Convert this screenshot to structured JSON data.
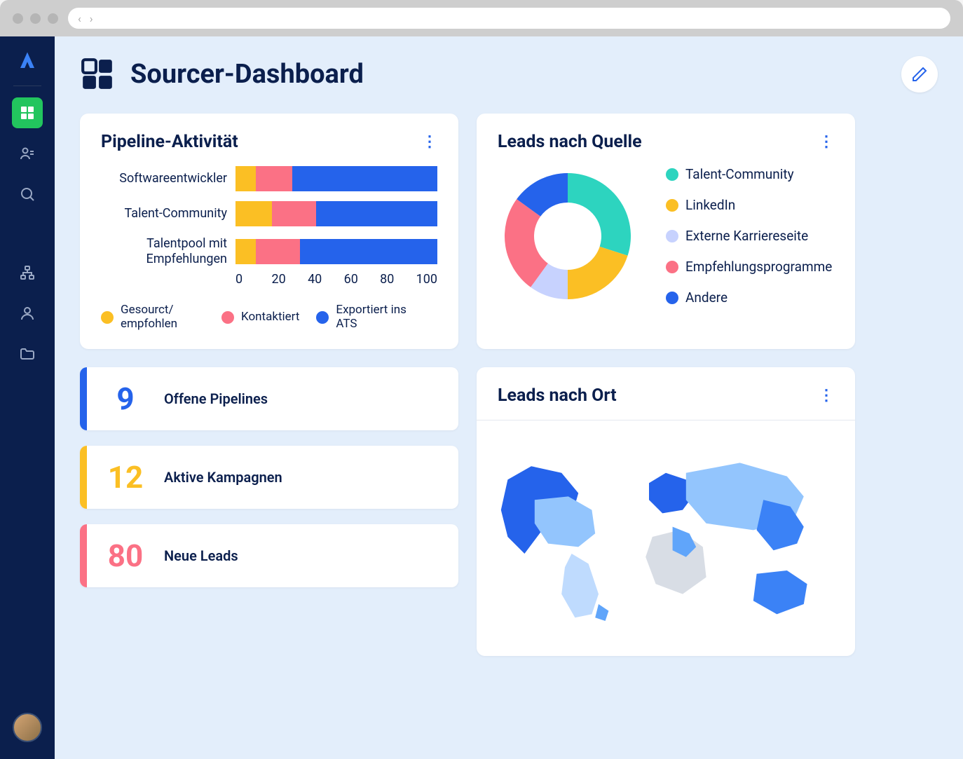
{
  "page": {
    "title": "Sourcer-Dashboard"
  },
  "cards": {
    "pipeline": {
      "title": "Pipeline-Aktivität"
    },
    "source": {
      "title": "Leads nach Quelle"
    },
    "location": {
      "title": "Leads nach Ort"
    }
  },
  "stats": [
    {
      "value": "9",
      "label": "Offene Pipelines",
      "color": "#2563eb"
    },
    {
      "value": "12",
      "label": "Aktive Kampagnen",
      "color": "#fbbf24"
    },
    {
      "value": "80",
      "label": "Neue Leads",
      "color": "#fb7185"
    }
  ],
  "chart_data": [
    {
      "type": "bar",
      "title": "Pipeline-Aktivität",
      "orientation": "horizontal",
      "stacked": true,
      "xlim": [
        0,
        100
      ],
      "xticks": [
        0,
        20,
        40,
        60,
        80,
        100
      ],
      "categories": [
        "Softwareentwickler",
        "Talent-Community",
        "Talentpool mit Empfehlungen"
      ],
      "series": [
        {
          "name": "Gesourct/ empfohlen",
          "color": "#fbbf24",
          "values": [
            10,
            18,
            10
          ]
        },
        {
          "name": "Kontaktiert",
          "color": "#fb7185",
          "values": [
            18,
            22,
            22
          ]
        },
        {
          "name": "Exportiert ins ATS",
          "color": "#2563eb",
          "values": [
            72,
            60,
            68
          ]
        }
      ]
    },
    {
      "type": "pie",
      "subtype": "donut",
      "title": "Leads nach Quelle",
      "series": [
        {
          "name": "Talent-Community",
          "color": "#2dd4bf",
          "value": 30
        },
        {
          "name": "LinkedIn",
          "color": "#fbbf24",
          "value": 20
        },
        {
          "name": "Externe Karriereseite",
          "color": "#c7d2fe",
          "value": 10
        },
        {
          "name": "Empfehlungsprogramme",
          "color": "#fb7185",
          "value": 25
        },
        {
          "name": "Andere",
          "color": "#2563eb",
          "value": 15
        }
      ]
    },
    {
      "type": "map",
      "title": "Leads nach Ort",
      "note": "Weltkarte Choroplethenkarte, blaue Abstufungen nach Lead-Anzahl pro Land"
    }
  ]
}
